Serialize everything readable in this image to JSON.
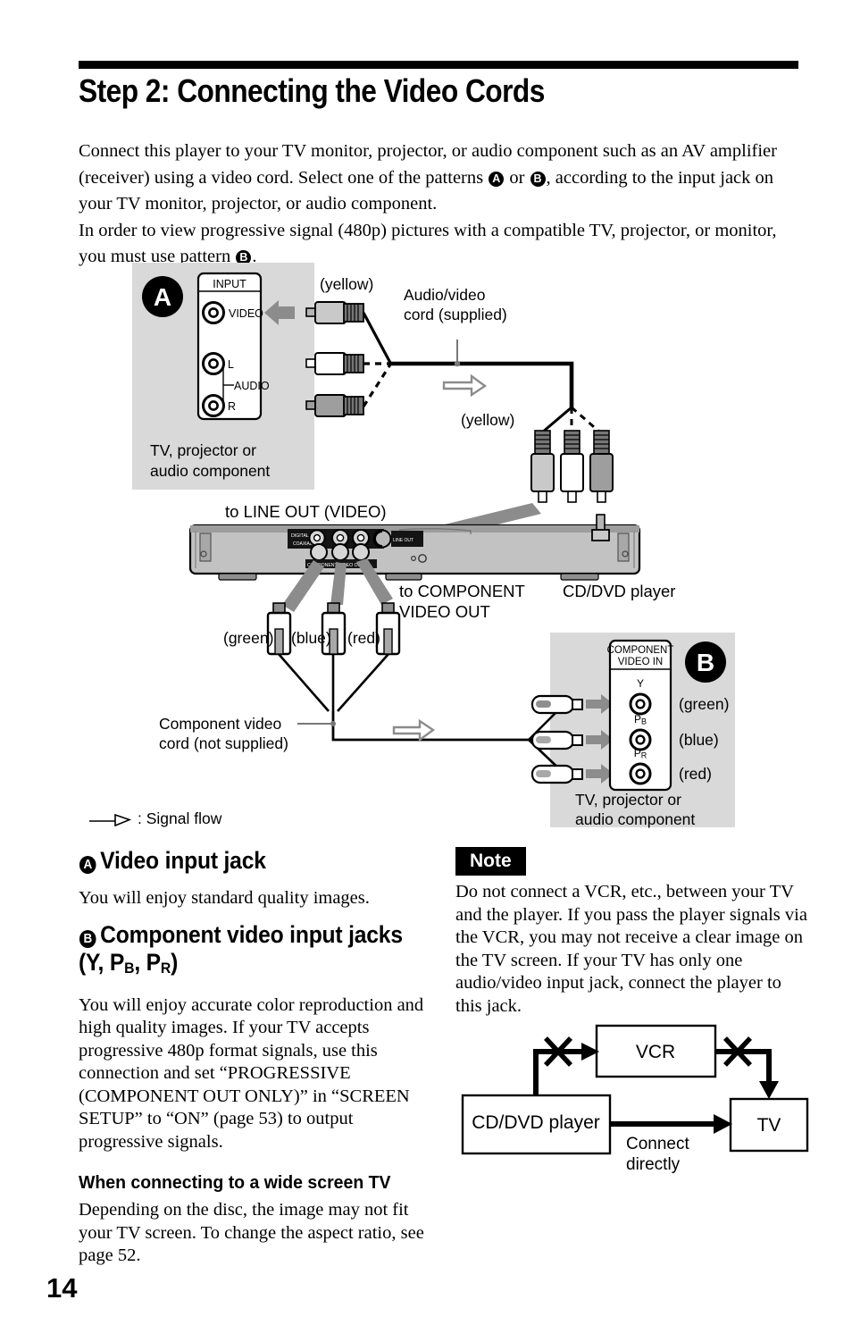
{
  "document": {
    "page_number": "14",
    "title": "Step 2: Connecting the Video Cords",
    "intro": {
      "line1_a": "Connect this player to your TV monitor, projector, or audio component such as an AV amplifier (receiver) using a video cord. Select one of the patterns ",
      "badge_a": "A",
      "line1_b": " or ",
      "badge_b": "B",
      "line1_c": ", according to the input jack on your TV monitor, projector, or audio component.",
      "line2_a": "In order to view progressive signal (480p) pictures with a compatible TV, projector, or monitor, you must use pattern ",
      "badge_c": "B",
      "line2_b": "."
    }
  },
  "diagram": {
    "panel_a": {
      "badge": "A",
      "jack_block_title": "INPUT",
      "jack_video": "VIDEO",
      "jack_l": "L",
      "jack_audio": "AUDIO",
      "jack_r": "R",
      "caption_line1": "TV, projector or",
      "caption_line2": "audio component"
    },
    "panel_b": {
      "badge": "B",
      "jack_block_title_line1": "COMPONENT",
      "jack_block_title_line2": "VIDEO IN",
      "jack_y": "Y",
      "jack_pb_main": "P",
      "jack_pb_sub": "B",
      "jack_pr_main": "P",
      "jack_pr_sub": "R",
      "color_green": "(green)",
      "color_blue": "(blue)",
      "color_red": "(red)",
      "caption_line1": "TV, projector or",
      "caption_line2": "audio component"
    },
    "labels": {
      "yellow_left": "(yellow)",
      "yellow_right": "(yellow)",
      "av_cord_line1": "Audio/video",
      "av_cord_line2": "cord (supplied)",
      "to_line_out": "to LINE OUT (VIDEO)",
      "to_component_line1": "to COMPONENT",
      "to_component_line2": "VIDEO OUT",
      "cd_dvd_player": "CD/DVD player",
      "green": "(green)",
      "blue": "(blue)",
      "red": "(red)",
      "comp_cord_line1": "Component video",
      "comp_cord_line2": "cord (not supplied)",
      "rear_digital_out": "DIGITAL OUT",
      "rear_coaxial": "COAXIAL",
      "rear_component": "COMPONENT VIDEO OUT"
    },
    "legend": ": Signal flow"
  },
  "sections": {
    "a": {
      "badge": "A",
      "heading": "Video input jack",
      "body": "You will enjoy standard quality images."
    },
    "b": {
      "badge": "B",
      "heading_line1": "Component video input jacks",
      "heading_line2_pre": "(Y, P",
      "heading_line2_sub1": "B",
      "heading_line2_mid": ", P",
      "heading_line2_sub2": "R",
      "heading_line2_post": ")",
      "body": "You will enjoy accurate color reproduction and high quality images. If your TV accepts progressive 480p format signals, use this connection and set “PROGRESSIVE (COMPONENT OUT ONLY)” in “SCREEN SETUP” to “ON” (page 53) to output progressive signals."
    },
    "wide": {
      "heading": "When connecting to a wide screen TV",
      "body": "Depending on the disc, the image may not fit your TV screen. To change the aspect ratio, see page 52."
    }
  },
  "note": {
    "tag": "Note",
    "body": "Do not connect a VCR, etc., between your TV and the player. If you pass the player signals via the VCR, you may not receive a clear image on the TV screen. If your TV has only one audio/video input jack, connect the player to this jack."
  },
  "vcr_figure": {
    "vcr": "VCR",
    "player": "CD/DVD player",
    "tv": "TV",
    "connect_line1": "Connect",
    "connect_line2": "directly"
  },
  "colors": {
    "panel_gray": "#d9d9d9",
    "arrow_gray": "#8c8c8c",
    "device_body": "#b8b8b8",
    "plug_yellow": "#cfcfcf",
    "plug_white": "#ffffff",
    "plug_red": "#9e9e9e",
    "black": "#000000"
  }
}
